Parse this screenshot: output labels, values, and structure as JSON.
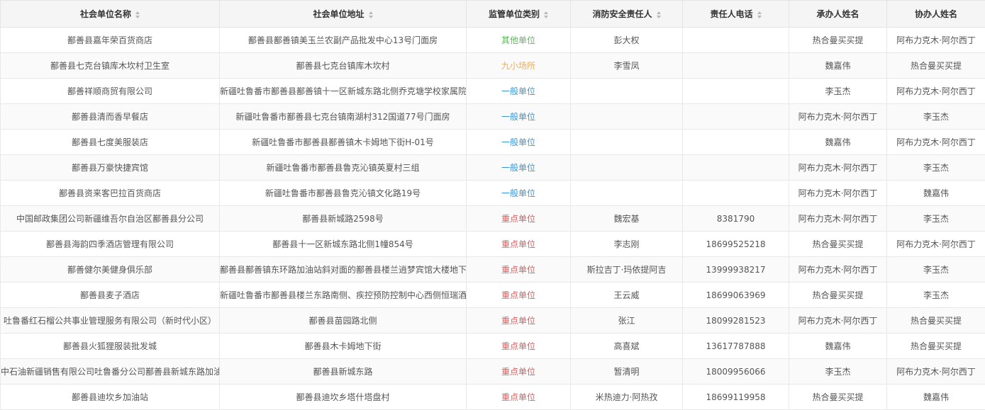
{
  "table": {
    "headers": [
      {
        "label": "社会单位名称",
        "sortable": true
      },
      {
        "label": "社会单位地址",
        "sortable": true
      },
      {
        "label": "监管单位类别",
        "sortable": true
      },
      {
        "label": "消防安全责任人",
        "sortable": true
      },
      {
        "label": "责任人电话",
        "sortable": true
      },
      {
        "label": "承办人姓名",
        "sortable": false
      },
      {
        "label": "协办人姓名",
        "sortable": false
      }
    ],
    "category_colors": {
      "其他单位": "#5cb85c",
      "九小场所": "#f0ad4e",
      "一般单位": "#3a97d4",
      "重点单位": "#e05a5a"
    },
    "rows": [
      {
        "name": "鄯善县嘉年荣百货商店",
        "address": "鄯善县鄯善镇美玉兰农副产品批发中心13号门面房",
        "category": "其他单位",
        "person": "彭大权",
        "phone": "",
        "handler": "热合曼买买提",
        "assistant": "阿布力克木·阿尔西丁"
      },
      {
        "name": "鄯善县七克台镇库木坎村卫生室",
        "address": "鄯善县七克台镇库木坎村",
        "category": "九小场所",
        "person": "李雪凤",
        "phone": "",
        "handler": "魏嘉伟",
        "assistant": "热合曼买买提"
      },
      {
        "name": "鄯善祥顺商贸有限公司",
        "address": "新疆吐鲁番市鄯善县鄯善镇十一区新城东路北侧乔克塘学校家属院",
        "category": "一般单位",
        "person": "",
        "phone": "",
        "handler": "李玉杰",
        "assistant": "阿布力克木·阿尔西丁"
      },
      {
        "name": "鄯善县清而香早餐店",
        "address": "新疆吐鲁番市鄯善县七克台镇南湖村312国道77号门面房",
        "category": "一般单位",
        "person": "",
        "phone": "",
        "handler": "阿布力克木·阿尔西丁",
        "assistant": "李玉杰"
      },
      {
        "name": "鄯善县七度美服装店",
        "address": "新疆吐鲁番市鄯善县鄯善镇木卡姆地下街H-01号",
        "category": "一般单位",
        "person": "",
        "phone": "",
        "handler": "魏嘉伟",
        "assistant": "阿布力克木·阿尔西丁"
      },
      {
        "name": "鄯善县万豪快捷宾馆",
        "address": "新疆吐鲁番市鄯善县鲁克沁镇英夏村三组",
        "category": "一般单位",
        "person": "",
        "phone": "",
        "handler": "阿布力克木·阿尔西丁",
        "assistant": "李玉杰"
      },
      {
        "name": "鄯善县资来客巴拉百货商店",
        "address": "新疆吐鲁番市鄯善县鲁克沁镇文化路19号",
        "category": "一般单位",
        "person": "",
        "phone": "",
        "handler": "阿布力克木·阿尔西丁",
        "assistant": "魏嘉伟"
      },
      {
        "name": "中国邮政集团公司新疆维吾尔自治区鄯善县分公司",
        "address": "鄯善县新城路2598号",
        "category": "重点单位",
        "person": "魏宏基",
        "phone": "8381790",
        "handler": "阿布力克木·阿尔西丁",
        "assistant": "李玉杰"
      },
      {
        "name": "鄯善县海韵四季酒店管理有限公司",
        "address": "鄯善县十一区新城东路北侧1幢854号",
        "category": "重点单位",
        "person": "李志刚",
        "phone": "18699525218",
        "handler": "热合曼买买提",
        "assistant": "阿布力克木·阿尔西丁"
      },
      {
        "name": "鄯善健尔美健身俱乐部",
        "address": "鄯善县鄯善镇东环路加油站斜对面的鄯善县楼兰逍梦宾馆大楼地下",
        "category": "重点单位",
        "person": "斯拉吉丁·玛依提阿吉",
        "phone": "13999938217",
        "handler": "阿布力克木·阿尔西丁",
        "assistant": "李玉杰"
      },
      {
        "name": "鄯善县麦子酒店",
        "address": "新疆吐鲁番市鄯善县楼兰东路南侧、疾控预防控制中心西侧恒瑞酒",
        "category": "重点单位",
        "person": "王云威",
        "phone": "18699063969",
        "handler": "热合曼买买提",
        "assistant": "李玉杰"
      },
      {
        "name": "吐鲁番红石榴公共事业管理服务有限公司（新时代小区）",
        "address": "鄯善县苗园路北侧",
        "category": "重点单位",
        "person": "张江",
        "phone": "18099281523",
        "handler": "阿布力克木·阿尔西丁",
        "assistant": "热合曼买买提"
      },
      {
        "name": "鄯善县火狐狸服装批发城",
        "address": "鄯善县木卡姆地下街",
        "category": "重点单位",
        "person": "高喜斌",
        "phone": "13617787888",
        "handler": "魏嘉伟",
        "assistant": "热合曼买买提"
      },
      {
        "name": "中石油新疆销售有限公司吐鲁番分公司鄯善县新城东路加油",
        "address": "鄯善县新城东路",
        "category": "重点单位",
        "person": "暂清明",
        "phone": "18009956066",
        "handler": "李玉杰",
        "assistant": "阿布力克木·阿尔西丁"
      },
      {
        "name": "鄯善县迪坎乡加油站",
        "address": "鄯善县迪坎乡塔什塔盘村",
        "category": "重点单位",
        "person": "米热迪力·阿热孜",
        "phone": "18699119958",
        "handler": "热合曼买买提",
        "assistant": "魏嘉伟"
      }
    ]
  }
}
